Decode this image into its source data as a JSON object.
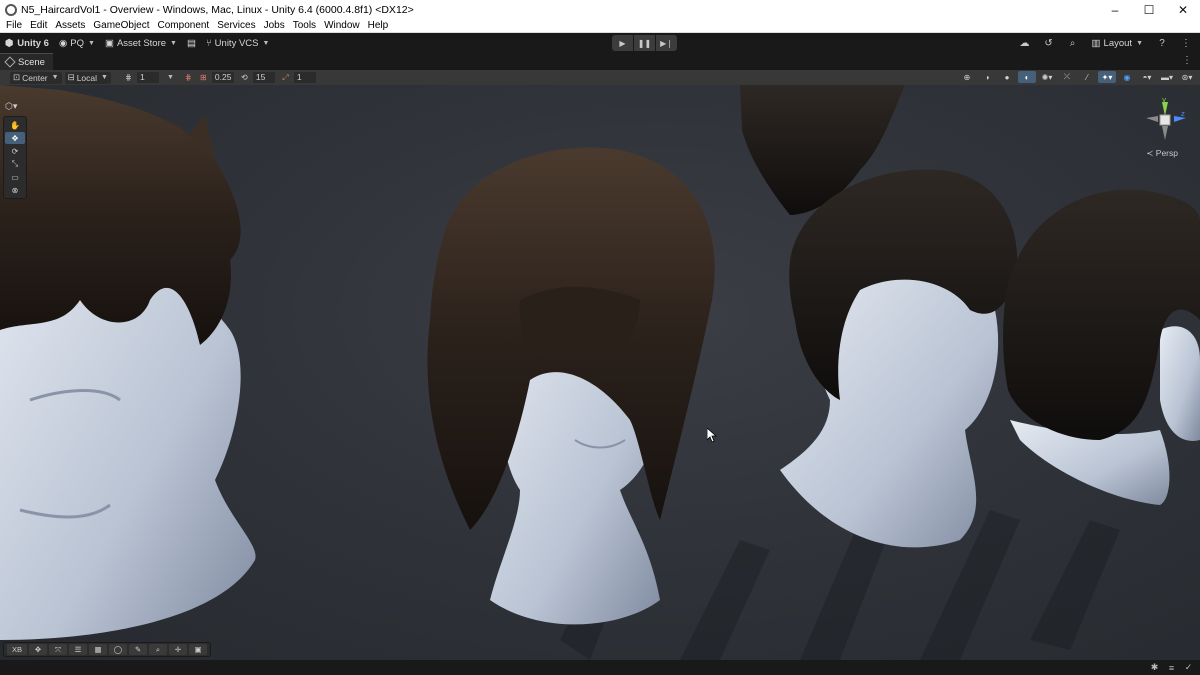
{
  "window": {
    "title": "N5_HaircardVol1 - Overview - Windows, Mac, Linux - Unity 6.4 (6000.4.8f1) <DX12>",
    "controls": {
      "minimize": "–",
      "maximize": "☐",
      "close": "✕"
    }
  },
  "menu": {
    "items": [
      "File",
      "Edit",
      "Assets",
      "GameObject",
      "Component",
      "Services",
      "Jobs",
      "Tools",
      "Window",
      "Help"
    ]
  },
  "toolbar": {
    "unity_label": "Unity 6",
    "account_label": "PQ",
    "asset_store_label": "Asset Store",
    "vcs_label": "Unity VCS",
    "layout_label": "Layout"
  },
  "scene_tab": {
    "label": "Scene"
  },
  "scene_toolbar": {
    "pivot_label": "Center",
    "space_label": "Local",
    "grid_value": "1",
    "snap_value": "0.25",
    "rotate_snap_value": "15",
    "scale_snap_value": "1"
  },
  "gizmo": {
    "projection_label": "Persp",
    "y_axis": "y",
    "z_axis": "z"
  },
  "overlay": {
    "xr_label": "XB"
  },
  "colors": {
    "accent": "#46607c",
    "highlight": "#4aa3ff",
    "viewport_bg": "#30343a"
  }
}
